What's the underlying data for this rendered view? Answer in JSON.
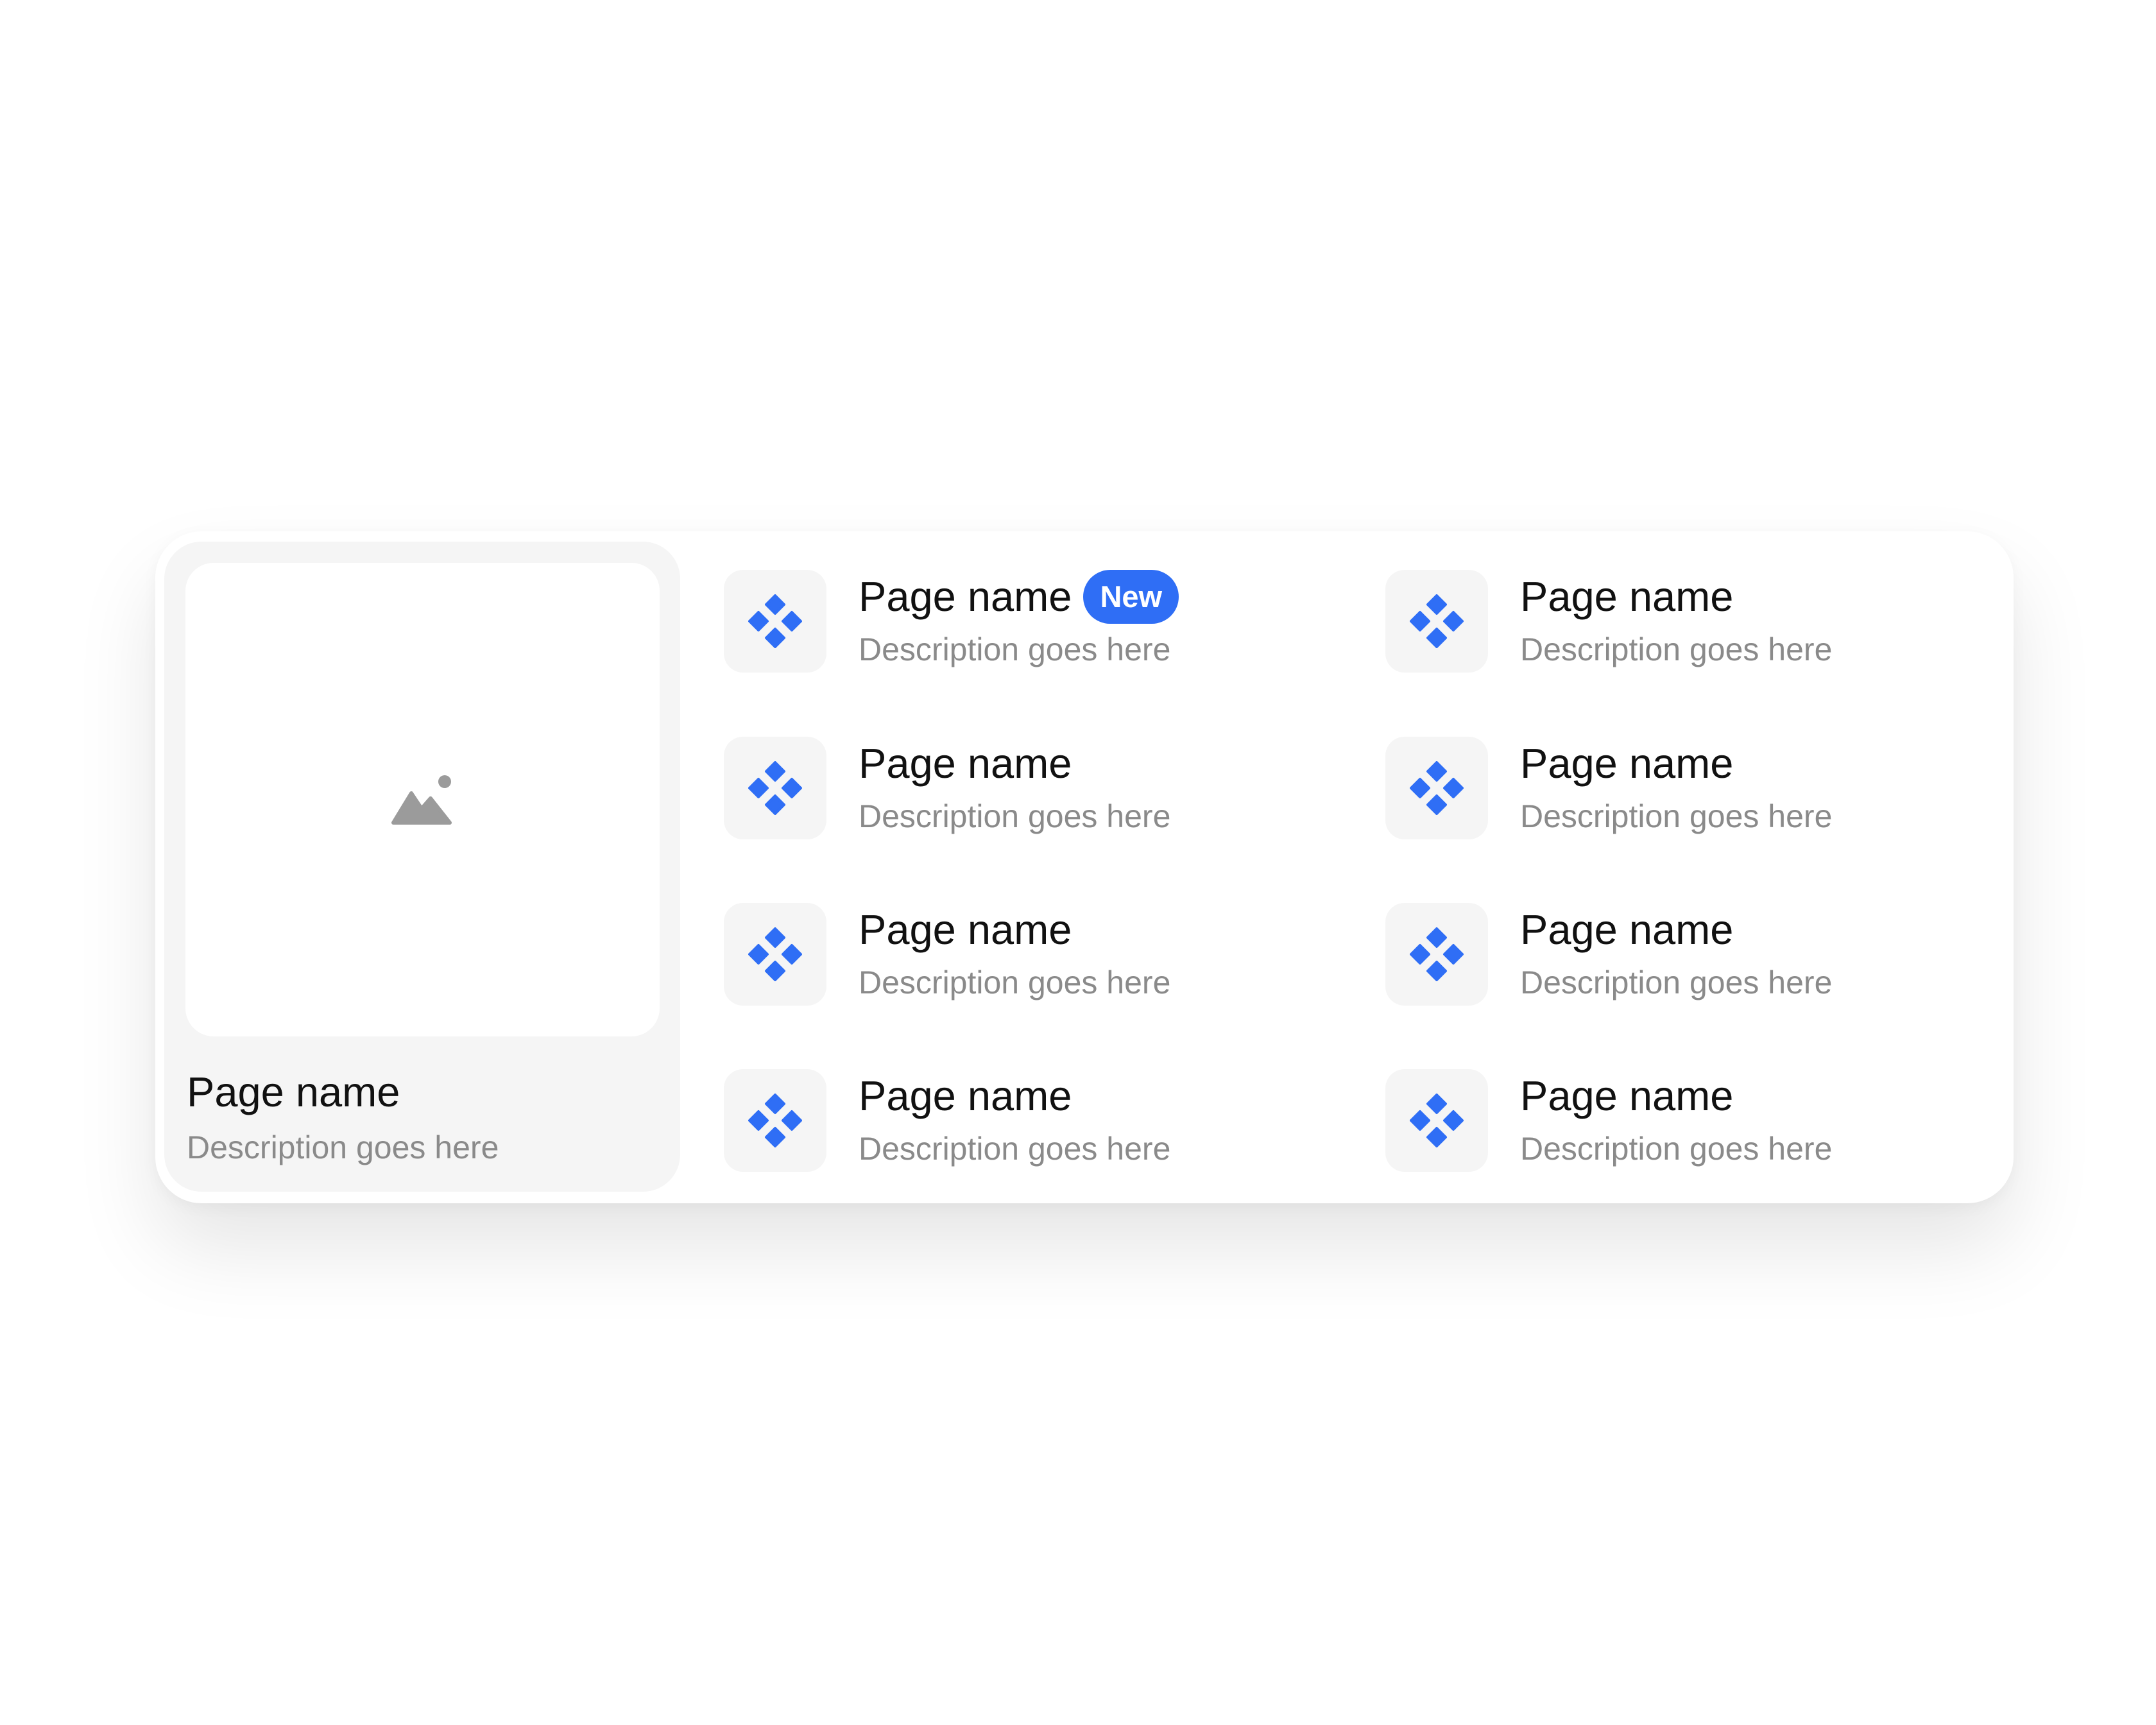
{
  "colors": {
    "accent": "#2f6ef5",
    "icon_tile_bg": "#f5f5f5",
    "title_text": "#111111",
    "description_text": "#8a8a8a"
  },
  "feature": {
    "image_icon": "image-placeholder-icon",
    "title": "Page name",
    "description": "Description goes here"
  },
  "items": [
    {
      "icon": "component-icon",
      "title": "Page name",
      "description": "Description goes here",
      "badge": "New"
    },
    {
      "icon": "component-icon",
      "title": "Page name",
      "description": "Description goes here"
    },
    {
      "icon": "component-icon",
      "title": "Page name",
      "description": "Description goes here"
    },
    {
      "icon": "component-icon",
      "title": "Page name",
      "description": "Description goes here"
    },
    {
      "icon": "component-icon",
      "title": "Page name",
      "description": "Description goes here"
    },
    {
      "icon": "component-icon",
      "title": "Page name",
      "description": "Description goes here"
    },
    {
      "icon": "component-icon",
      "title": "Page name",
      "description": "Description goes here"
    },
    {
      "icon": "component-icon",
      "title": "Page name",
      "description": "Description goes here"
    }
  ]
}
